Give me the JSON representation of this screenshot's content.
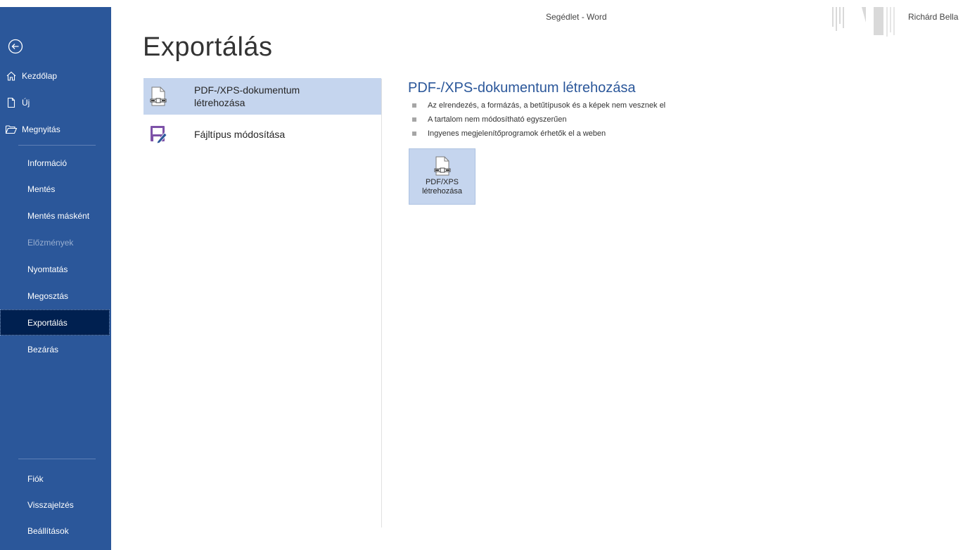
{
  "window": {
    "title": "Segédlet - Word",
    "user": "Richárd Bella"
  },
  "colors": {
    "sidebar": "#2b579a",
    "active_nav": "#002050",
    "selected": "#c5d5ee",
    "accent": "#2b579a",
    "pdf_icon_purple": "#7d52a8"
  },
  "sidebar": {
    "back_icon": "back-arrow-icon",
    "top_items": [
      {
        "label": "Kezdőlap",
        "icon": "home-icon"
      },
      {
        "label": "Új",
        "icon": "new-document-icon"
      },
      {
        "label": "Megnyitás",
        "icon": "open-folder-icon"
      }
    ],
    "items": [
      {
        "label": "Információ"
      },
      {
        "label": "Mentés"
      },
      {
        "label": "Mentés másként"
      },
      {
        "label": "Előzmények",
        "disabled": true
      },
      {
        "label": "Nyomtatás"
      },
      {
        "label": "Megosztás"
      },
      {
        "label": "Exportálás",
        "active": true
      },
      {
        "label": "Bezárás"
      }
    ],
    "bottom_items": [
      {
        "label": "Fiók"
      },
      {
        "label": "Visszajelzés"
      },
      {
        "label": "Beállítások"
      }
    ]
  },
  "main": {
    "title": "Exportálás",
    "options": [
      {
        "label": "PDF-/XPS-dokumentum létrehozása",
        "icon": "pdf-xps-document-icon",
        "selected": true
      },
      {
        "label": "Fájltípus módosítása",
        "icon": "change-file-type-icon",
        "selected": false
      }
    ],
    "detail": {
      "title": "PDF-/XPS-dokumentum létrehozása",
      "bullets": [
        "Az elrendezés, a formázás, a betűtípusok és a képek nem vesznek el",
        "A tartalom nem módosítható egyszerűen",
        "Ingyenes megjelenítőprogramok érhetők el a weben"
      ],
      "button_label": "PDF/XPS létrehozása"
    }
  }
}
